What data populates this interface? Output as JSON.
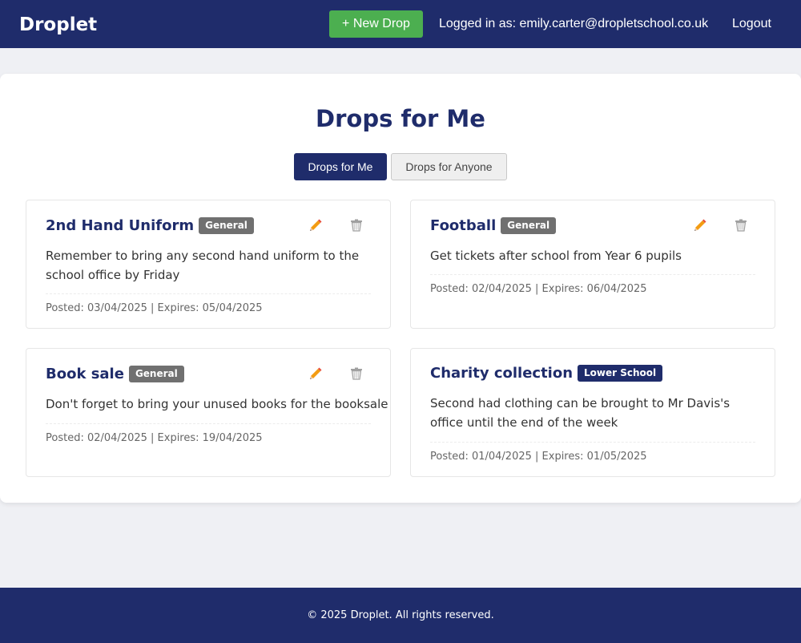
{
  "header": {
    "brand": "Droplet",
    "new_drop_label": "+ New Drop",
    "user_status": "Logged in as: emily.carter@dropletschool.co.uk",
    "logout_label": "Logout"
  },
  "page": {
    "title": "Drops for Me",
    "tabs": [
      {
        "label": "Drops for Me",
        "active": true
      },
      {
        "label": "Drops for Anyone",
        "active": false
      }
    ]
  },
  "drops": [
    {
      "title": "2nd Hand Uniform",
      "tag": "General",
      "description": "Remember to bring any second hand uniform to the school office by Friday",
      "meta": "Posted: 03/04/2025 | Expires: 05/04/2025",
      "editable": true
    },
    {
      "title": "Football",
      "tag": "General",
      "description": "Get tickets after school from Year 6 pupils",
      "meta": "Posted: 02/04/2025 | Expires: 06/04/2025",
      "editable": true
    },
    {
      "title": "Book sale",
      "tag": "General",
      "description": "Don't forget to bring your unused books for the booksale",
      "meta": "Posted: 02/04/2025 | Expires: 19/04/2025",
      "editable": true
    },
    {
      "title": "Charity collection",
      "tag": "Lower School",
      "description": "Second had clothing can be brought to Mr Davis's office until the end of the week",
      "meta": "Posted: 01/04/2025 | Expires: 01/05/2025",
      "editable": false
    }
  ],
  "icons": {
    "edit": "pencil-icon",
    "delete": "trash-icon"
  },
  "colors": {
    "primary": "#1f2c6b",
    "new_drop": "#4caf50",
    "badge_general": "#707070",
    "background": "#eff0f4"
  },
  "footer": {
    "text": "© 2025 Droplet. All rights reserved."
  }
}
